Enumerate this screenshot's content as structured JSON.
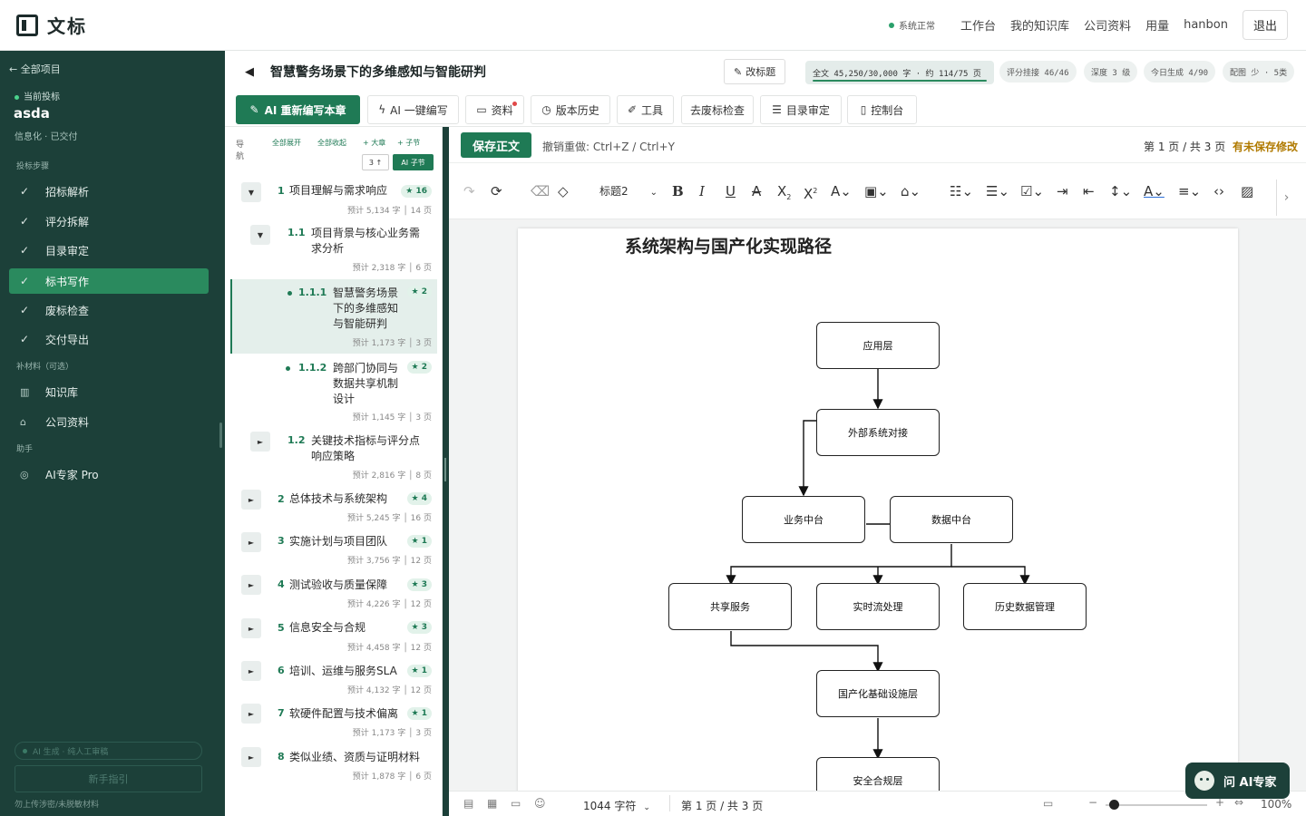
{
  "app": {
    "name": "文标"
  },
  "topnav": {
    "status": "系统正常",
    "links": [
      "工作台",
      "我的知识库",
      "公司资料",
      "用量"
    ],
    "user": "hanbon",
    "logout": "退出"
  },
  "sidebar": {
    "back": "← 全部项目",
    "current_label": "当前投标",
    "project_name": "asda",
    "project_meta": "信息化 · 已交付",
    "steps_heading": "投标步骤",
    "steps": [
      {
        "label": "招标解析",
        "check": "✓"
      },
      {
        "label": "评分拆解",
        "check": "✓"
      },
      {
        "label": "目录审定",
        "check": "✓"
      },
      {
        "label": "标书写作",
        "check": "✓"
      },
      {
        "label": "废标检查",
        "check": "✓"
      },
      {
        "label": "交付导出",
        "check": "✓"
      }
    ],
    "materials_heading": "补材料（可选）",
    "materials": [
      {
        "label": "知识库",
        "icon": "book-icon"
      },
      {
        "label": "公司资料",
        "icon": "building-icon"
      }
    ],
    "assistant_heading": "助手",
    "assistant": [
      {
        "label": "AI专家 Pro",
        "icon": "chat-icon"
      }
    ],
    "ai_status": "AI 生成 · 纯人工审稿",
    "guide": "新手指引",
    "footer": "勿上传涉密/未脱敏材料"
  },
  "doc": {
    "back_icon": "◀",
    "title": "智慧警务场景下的多维感知与智能研判",
    "rename": "改标题",
    "chips": {
      "fulltext": "全文 45,250/30,000 字 · 约 114/75 页",
      "score": "评分挂接 46/46",
      "depth": "深度 3 级",
      "today": "今日生成 4/90",
      "config": "配图 少 · 5类"
    }
  },
  "toolbar": {
    "rewrite": "AI 重新编写本章",
    "oneclick": "AI 一键编写",
    "materials": "资料",
    "history": "版本历史",
    "tools": "工具",
    "dewaste": "去废标检查",
    "toc": "目录审定",
    "console": "控制台"
  },
  "outline": {
    "nav_label": "导航",
    "expand_all": "全部展开",
    "collapse_all": "全部收起",
    "add_chapter": "+ 大章",
    "add_section": "+ 子节",
    "mini_up": "3 ↑",
    "mini_ai": "AI 子节",
    "items": [
      {
        "num": "1",
        "label": "项目理解与需求响应",
        "badge": "★ 16",
        "words": "预计 5,134 字",
        "pages": "14 页",
        "toggle": "▼"
      },
      {
        "num": "1.1",
        "label": "项目背景与核心业务需求分析",
        "words": "预计 2,318 字",
        "pages": "6 页",
        "toggle": "▼"
      },
      {
        "num": "1.1.1",
        "label": "智慧警务场景下的多维感知与智能研判",
        "badge": "★ 2",
        "words": "预计 1,173 字",
        "pages": "3 页"
      },
      {
        "num": "1.1.2",
        "label": "跨部门协同与数据共享机制设计",
        "badge": "★ 2",
        "words": "预计 1,145 字",
        "pages": "3 页"
      },
      {
        "num": "1.2",
        "label": "关键技术指标与评分点响应策略",
        "words": "预计 2,816 字",
        "pages": "8 页",
        "toggle": "►"
      },
      {
        "num": "2",
        "label": "总体技术与系统架构",
        "badge": "★ 4",
        "words": "预计 5,245 字",
        "pages": "16 页",
        "toggle": "►"
      },
      {
        "num": "3",
        "label": "实施计划与项目团队",
        "badge": "★ 1",
        "words": "预计 3,756 字",
        "pages": "12 页",
        "toggle": "►"
      },
      {
        "num": "4",
        "label": "测试验收与质量保障",
        "badge": "★ 3",
        "words": "预计 4,226 字",
        "pages": "12 页",
        "toggle": "►"
      },
      {
        "num": "5",
        "label": "信息安全与合规",
        "badge": "★ 3",
        "words": "预计 4,458 字",
        "pages": "12 页",
        "toggle": "►"
      },
      {
        "num": "6",
        "label": "培训、运维与服务SLA",
        "badge": "★ 1",
        "words": "预计 4,132 字",
        "pages": "12 页",
        "toggle": "►"
      },
      {
        "num": "7",
        "label": "软硬件配置与技术偏离",
        "badge": "★ 1",
        "words": "预计 1,173 字",
        "pages": "3 页",
        "toggle": "►"
      },
      {
        "num": "8",
        "label": "类似业绩、资质与证明材料",
        "words": "预计 1,878 字",
        "pages": "6 页",
        "toggle": "►"
      }
    ]
  },
  "editor": {
    "save": "保存正文",
    "undo_hint": "撤销重做: Ctrl+Z / Ctrl+Y",
    "page_info": "第 1 页 / 共 3 页",
    "unsaved": "有未保存修改",
    "heading_select": "标题2",
    "doc_heading": "系统架构与国产化实现路径",
    "diagram_nodes": [
      "应用层",
      "外部系统对接",
      "业务中台",
      "数据中台",
      "共享服务",
      "实时流处理",
      "历史数据管理",
      "国产化基础设施层",
      "安全合规层"
    ]
  },
  "statusbar": {
    "word_count": "1044 字符",
    "page_info": "第 1 页 / 共 3 页",
    "zoom": "100%",
    "zoom_level": 0.5
  },
  "ask_ai": "问 AI专家",
  "colors": {
    "sidebar": "#1c4039",
    "accent": "#1f7a55",
    "warn": "#b07a00"
  }
}
